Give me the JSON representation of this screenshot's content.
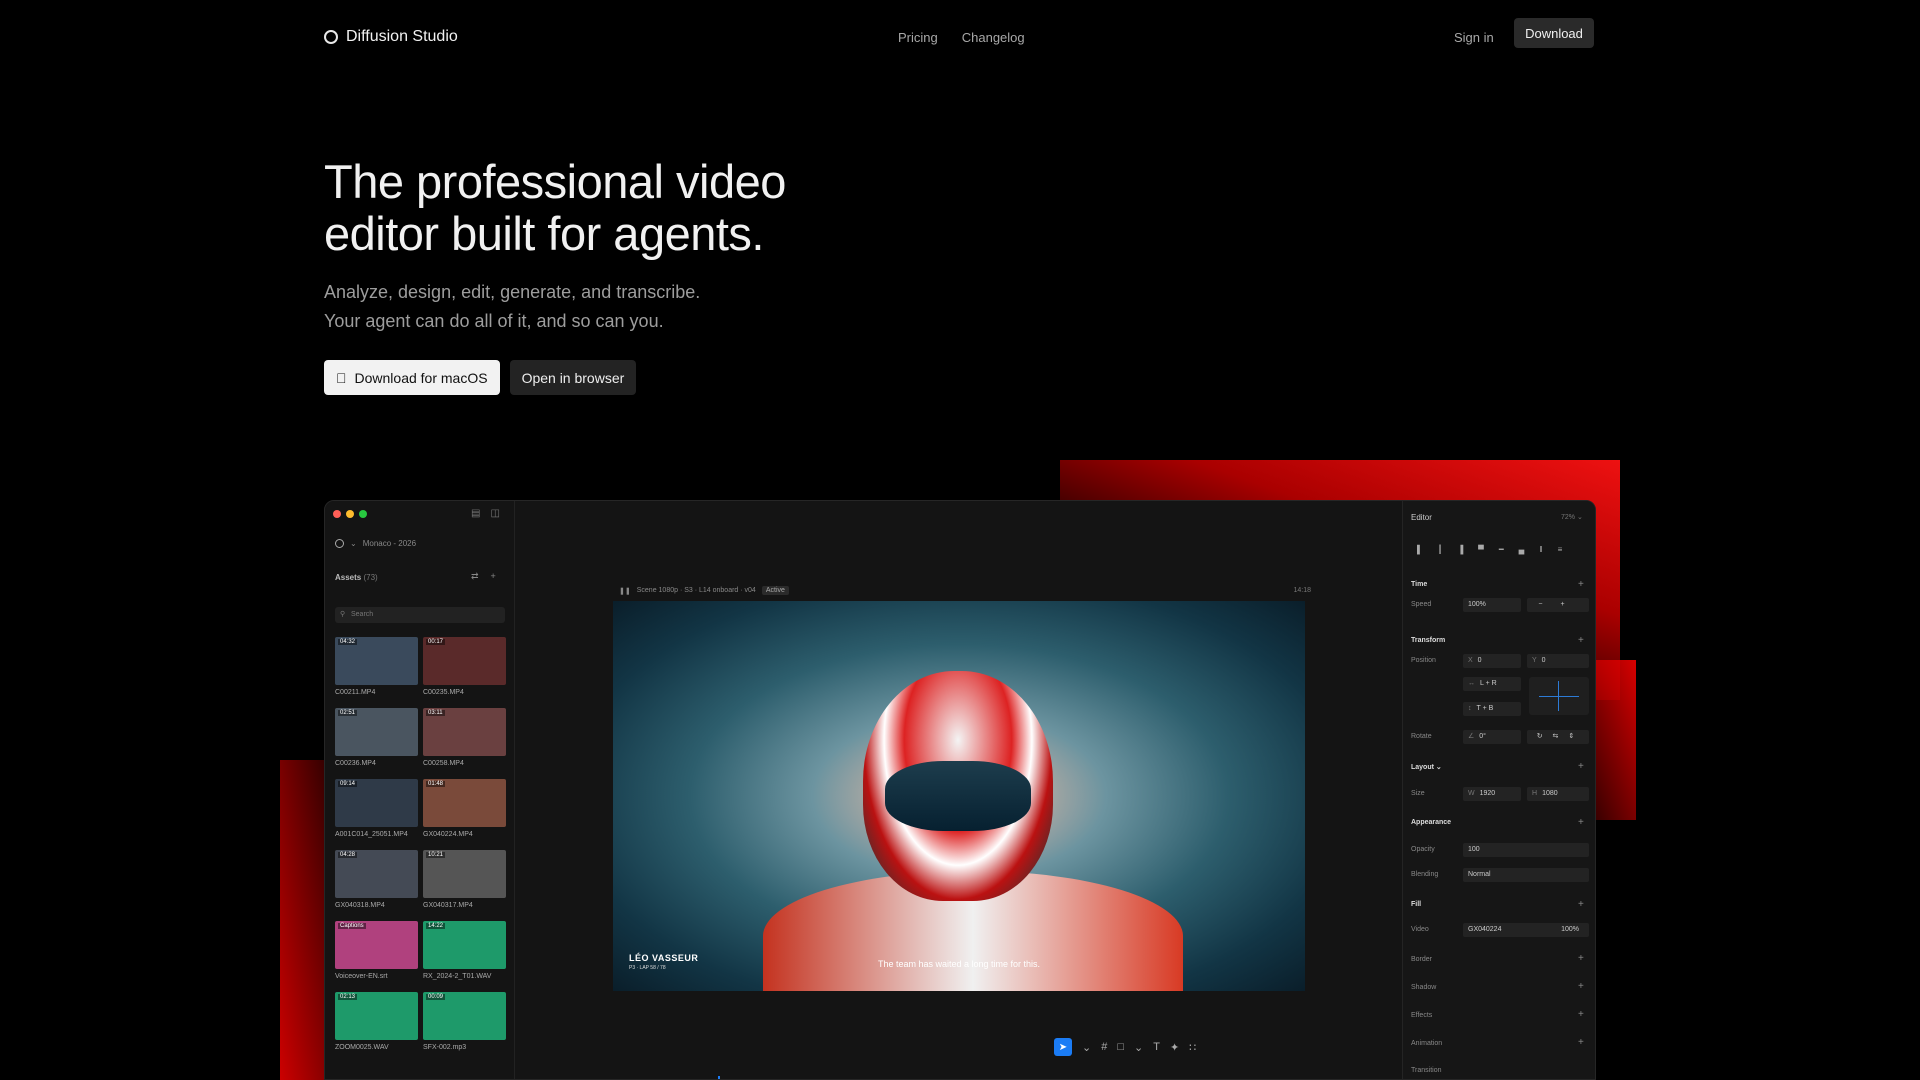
{
  "nav": {
    "brand": "Diffusion Studio",
    "links": [
      "Pricing",
      "Changelog"
    ],
    "signin": "Sign in",
    "download": "Download"
  },
  "hero": {
    "title": "The professional video editor built for agents.",
    "sub1": "Analyze, design, edit, generate, and transcribe.",
    "sub2": "Your agent can do all of it, and so can you."
  },
  "cta": {
    "primary": "Download for macOS",
    "secondary": "Open in browser"
  },
  "app": {
    "project": "Monaco - 2026",
    "assets_label": "Assets",
    "assets_count": "(73)",
    "search_placeholder": "Search",
    "tiles": [
      {
        "dur": "04:32",
        "name": "C00211.MP4",
        "c": "#3a4a5c"
      },
      {
        "dur": "00:17",
        "name": "C00235.MP4",
        "c": "#5a2a2a"
      },
      {
        "dur": "02:51",
        "name": "C00236.MP4",
        "c": "#4a5560"
      },
      {
        "dur": "03:11",
        "name": "C00258.MP4",
        "c": "#6a4040"
      },
      {
        "dur": "09:14",
        "name": "A001C014_25051.MP4",
        "c": "#2f3a48"
      },
      {
        "dur": "01:48",
        "name": "GX040224.MP4",
        "c": "#7a4a3a"
      },
      {
        "dur": "04:28",
        "name": "GX040318.MP4",
        "c": "#444a55"
      },
      {
        "dur": "10:21",
        "name": "GX040317.MP4",
        "c": "#555"
      },
      {
        "dur": "Captions",
        "name": "Voiceover-EN.srt",
        "c": "#b0417e"
      },
      {
        "dur": "14:22",
        "name": "RX_2024-2_T01.WAV",
        "c": "#1e9a6a"
      },
      {
        "dur": "02:13",
        "name": "ZOOM0025.WAV",
        "c": "#1e9a6a"
      },
      {
        "dur": "00:09",
        "name": "SFX-002.mp3",
        "c": "#1e9a6a"
      }
    ],
    "scene": "Scene 1080p · S3 · L14 onboard · v04",
    "status": "Active",
    "timecode": "14:18",
    "driver": "LÉO VASSEUR",
    "driver_sub": "P3 · LAP 58 / 78",
    "caption": "The team has waited a long time for this.",
    "scene_label2": "Sc",
    "editor": {
      "title": "Editor",
      "zoom": "72%",
      "time": "Time",
      "speed_label": "Speed",
      "speed": "100%",
      "transform": "Transform",
      "position": "Position",
      "x": "0",
      "y": "0",
      "lr": "L + R",
      "tb": "T + B",
      "rotate": "Rotate",
      "rot": "0°",
      "layout": "Layout",
      "size": "Size",
      "w": "1920",
      "h": "1080",
      "appearance": "Appearance",
      "opacity_label": "Opacity",
      "opacity": "100",
      "blending_label": "Blending",
      "blending": "Normal",
      "fill": "Fill",
      "video_label": "Video",
      "video_name": "GX040224",
      "video_pct": "100%",
      "border": "Border",
      "shadow": "Shadow",
      "effects": "Effects",
      "animation": "Animation",
      "transition": "Transition"
    }
  }
}
